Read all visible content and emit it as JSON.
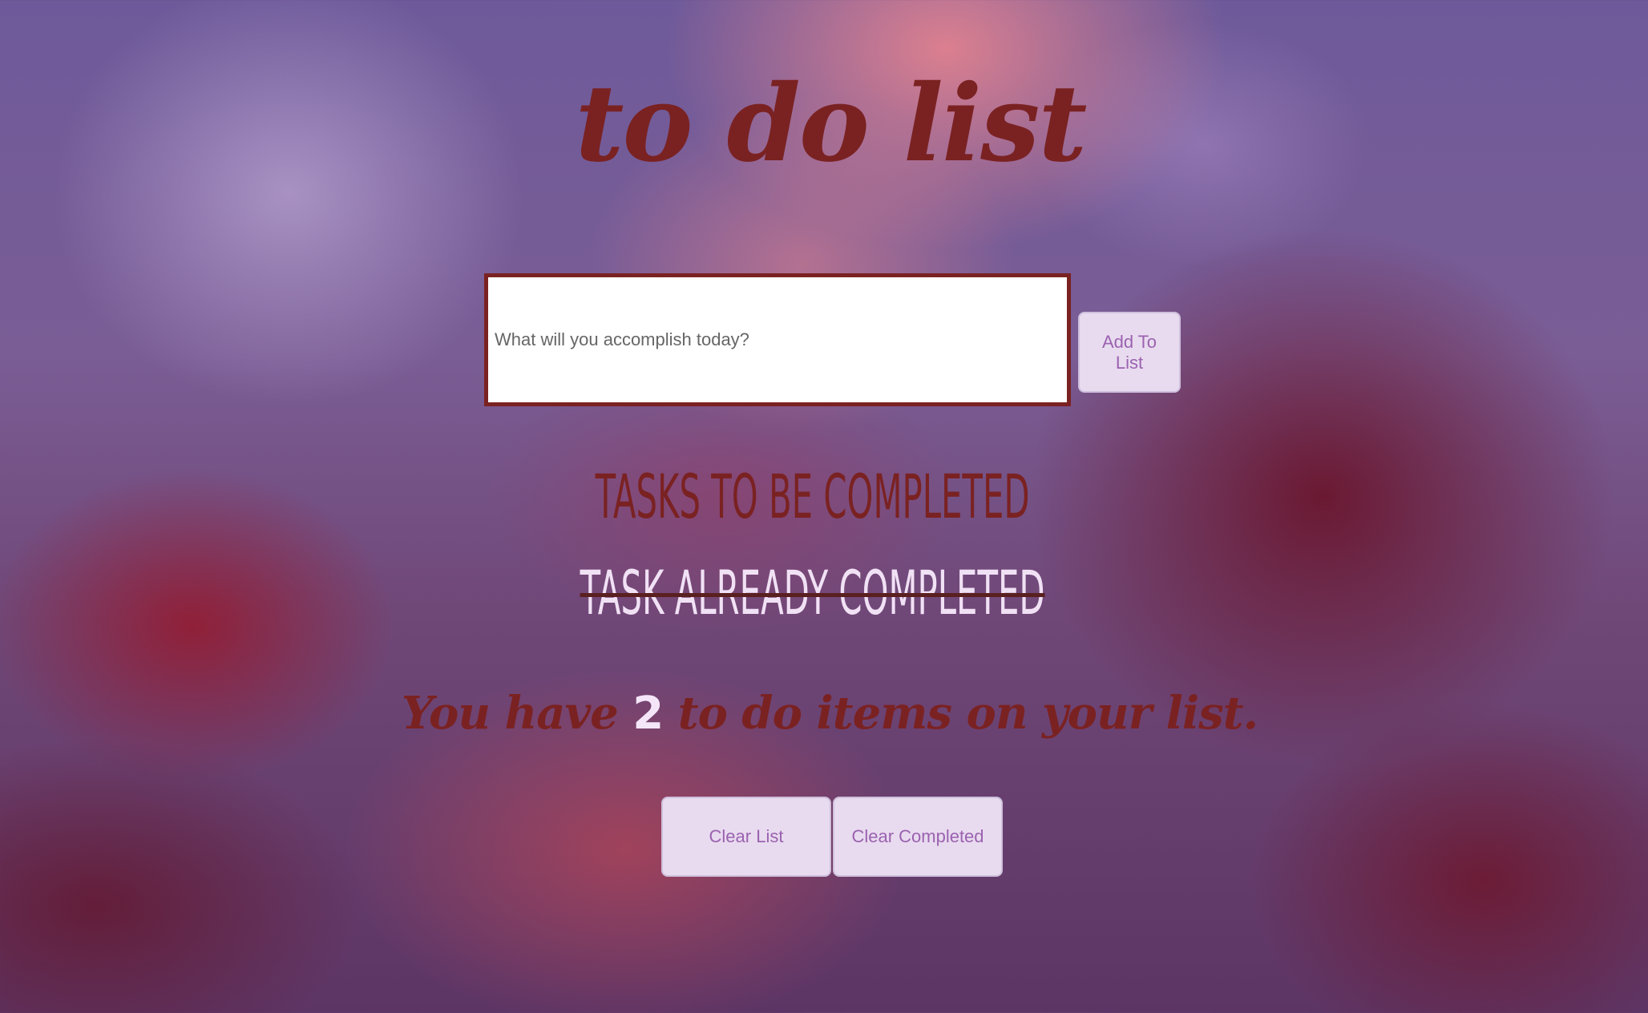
{
  "app": {
    "title": "to do list"
  },
  "input": {
    "placeholder": "What will you accomplish today?",
    "value": ""
  },
  "buttons": {
    "add_label": "Add To List",
    "clear_list_label": "Clear List",
    "clear_completed_label": "Clear Completed"
  },
  "tasks": [
    {
      "text": "tasks to be completed",
      "completed": false
    },
    {
      "text": "task already completed",
      "completed": true
    }
  ],
  "counter": {
    "prefix": "You have",
    "count": "2",
    "suffix": "to do items on your list."
  },
  "colors": {
    "accent": "#7a2222",
    "button_bg": "#e8dbef",
    "button_text": "#9b62b0",
    "completed_text": "#f1e1f5"
  }
}
